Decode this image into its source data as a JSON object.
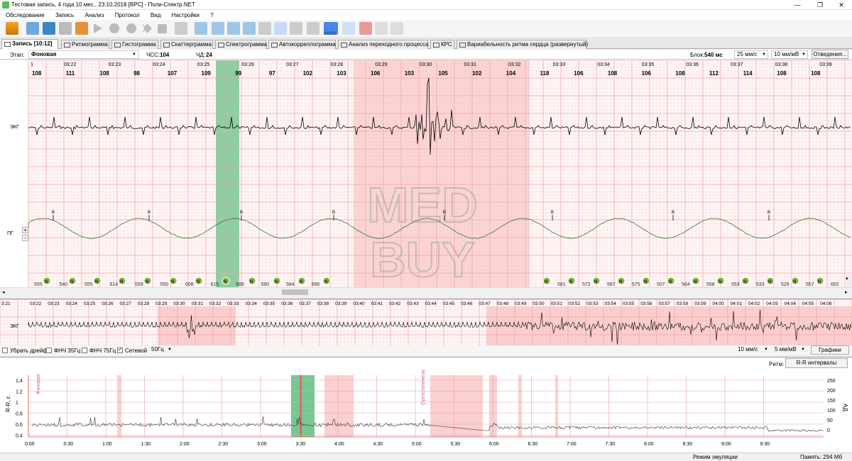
{
  "window": {
    "title": "Тестовая запись, 4 года 10 мес., 23.10.2018 [ВРС] - Поли-Спектр.NET"
  },
  "menu": [
    "Обследование",
    "Запись",
    "Анализ",
    "Протокол",
    "Вид",
    "Настройки",
    "?"
  ],
  "toolbar": {
    "auto_label": "AUTO"
  },
  "tabs": [
    "Запись [10:12]",
    "Ритмограмма",
    "Гистограмма",
    "Скаттерграмма",
    "Спектрограмма",
    "Автокорреллограмма",
    "Анализ переходного процесса",
    "КРС",
    "Вариабельность ритма сердца (развернутый)"
  ],
  "info": {
    "stage_label": "Этап:",
    "stage_value": "Фоновая",
    "hr_label": "ЧСС:",
    "hr_value": "104",
    "rr_label": "ЧД:",
    "rr_value": "24",
    "block_label": "Блок:",
    "block_value": "540 мс",
    "speed": "25 мм/с",
    "amp": "10 мм/мВ",
    "leads_btn": "Отведения..."
  },
  "top": {
    "marker_first": "1",
    "time_labels": [
      "03:22",
      "03:23",
      "03:24",
      "03:25",
      "03:26",
      "03:27",
      "03:28",
      "03:29",
      "03:30",
      "03:31",
      "03:32",
      "03:33",
      "03:34",
      "03:35",
      "03:36",
      "03:37",
      "03:38",
      "03:39"
    ],
    "hr_values": [
      "108",
      "111",
      "108",
      "98",
      "107",
      "109",
      "99",
      "97",
      "102",
      "103",
      "106",
      "103",
      "105",
      "102",
      "104",
      "118",
      "106",
      "108",
      "106",
      "108",
      "112",
      "114",
      "108",
      "108"
    ],
    "ecg_label": "ЭКГ",
    "pg_label": "ПГ",
    "pg_plus": "+",
    "pg_minus": "-",
    "peak_letter": "B",
    "rr_values": [
      "555",
      "540",
      "555",
      "614",
      "559",
      "550",
      "608",
      "615",
      "589",
      "580",
      "584",
      "566",
      "581",
      "572",
      "587",
      "575",
      "507",
      "564",
      "558",
      "553",
      "533",
      "526",
      "557",
      "602"
    ],
    "n_label": "N"
  },
  "mid": {
    "time_labels": [
      "3:21",
      "03:22",
      "03:23",
      "03:24",
      "03:25",
      "03:26",
      "03:27",
      "03:28",
      "03:29",
      "03:30",
      "03:31",
      "03:32",
      "03:33",
      "03:34",
      "03:35",
      "03:36",
      "03:37",
      "03:38",
      "03:39",
      "03:40",
      "03:41",
      "03:42",
      "03:43",
      "03:44",
      "03:45",
      "03:46",
      "03:47",
      "03:48",
      "03:49",
      "03:50",
      "03:51",
      "03:52",
      "03:53",
      "03:54",
      "03:55",
      "03:56",
      "03:57",
      "03:58",
      "03:59",
      "04:00",
      "04:01",
      "04:02",
      "04:03",
      "04:04",
      "04:05",
      "04:06"
    ],
    "ecg_label": "ЭКГ"
  },
  "filters": {
    "drift": "Убрать дрейф",
    "hp35": "ФНЧ 35Гц",
    "hp75": "ФНЧ 75Гц",
    "net": "Сетевой",
    "net_freq": "50Гц",
    "speed": "10 мм/с",
    "amp": "5 мм/мВ",
    "graphs_btn": "Графики"
  },
  "rhythm": {
    "label": "Ритм:",
    "value": "R-R интервалы"
  },
  "bottom": {
    "y_left_title": "R-R, с",
    "y_right_title": "АД",
    "y_left_ticks": [
      "1,4",
      "1,2",
      "1",
      "0,8",
      "0,6",
      "0,4"
    ],
    "y_right_ticks": [
      "250",
      "200",
      "150",
      "100",
      "50",
      "0"
    ],
    "x_ticks": [
      "0:00",
      "0:30",
      "1:00",
      "1:30",
      "2:00",
      "2:30",
      "3:00",
      "3:30",
      "4:00",
      "4:30",
      "5:00",
      "5:30",
      "6:00",
      "6:30",
      "7:00",
      "7:30",
      "8:00",
      "8:30",
      "9:00",
      "9:30"
    ],
    "stage1": "Фоновая",
    "stage2": "Ортостатическая"
  },
  "watermark": {
    "line1": "MED",
    "line2": "BUY"
  },
  "status": {
    "mode": "Режим эмуляции",
    "memory": "Память: 294 Мб"
  },
  "colors": {
    "grid_red": "#f2a2a2",
    "artifact_bg": "#fbd0d0",
    "green_mark": "#76c893",
    "trace": "#000000"
  }
}
